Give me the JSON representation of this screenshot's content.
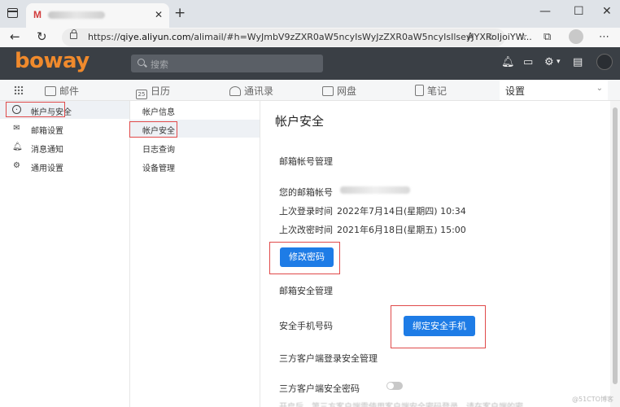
{
  "browser": {
    "tab_title": "",
    "tab_logo": "M",
    "url_host": "qiye.aliyun.com",
    "url_prefix": "https://",
    "url_rest": "/alimail/#h=WyJmbV9zZXR0aW5ncyIsWyJzZXR0aW5ncyIsIlseyJYXRoIjoiYW..."
  },
  "app": {
    "brand": "boway",
    "search_placeholder": "搜索"
  },
  "modules": [
    {
      "label": "邮件"
    },
    {
      "label": "日历",
      "badge": "25"
    },
    {
      "label": "通讯录"
    },
    {
      "label": "网盘"
    },
    {
      "label": "笔记"
    }
  ],
  "active_module": "设置",
  "settings_nav": [
    {
      "label": "帐户与安全",
      "icon": "user-icon",
      "selected": true
    },
    {
      "label": "邮箱设置",
      "icon": "mail-icon",
      "selected": false
    },
    {
      "label": "消息通知",
      "icon": "bell-icon",
      "selected": false
    },
    {
      "label": "通用设置",
      "icon": "gear-icon",
      "selected": false
    }
  ],
  "account_nav": [
    {
      "label": "帐户信息",
      "selected": false
    },
    {
      "label": "帐户安全",
      "selected": true
    },
    {
      "label": "日志查询",
      "selected": false
    },
    {
      "label": "设备管理",
      "selected": false
    }
  ],
  "content": {
    "title": "帐户安全",
    "section_account": "邮箱帐号管理",
    "email_label": "您的邮箱帐号",
    "last_login_label": "上次登录时间",
    "last_login_value": "2022年7月14日(星期四) 10:34",
    "last_pw_label": "上次改密时间",
    "last_pw_value": "2021年6月18日(星期五) 15:00",
    "change_pw_button": "修改密码",
    "section_security": "邮箱安全管理",
    "phone_label": "安全手机号码",
    "bind_phone_button": "绑定安全手机",
    "section_thirdparty": "三方客户端登录安全管理",
    "thirdparty_pw_label": "三方客户端安全密码",
    "thirdparty_pw_enabled": false,
    "cut_text": "开启后，第三方客户端需使用客户端安全密码登录，请在客户端的密码处填写"
  },
  "watermark": "@51CTO博客",
  "colors": {
    "brand": "#f08a2c",
    "header_bg": "#3a3f45",
    "primary_button": "#1e7ce6",
    "highlight_box": "#e04a4a"
  }
}
